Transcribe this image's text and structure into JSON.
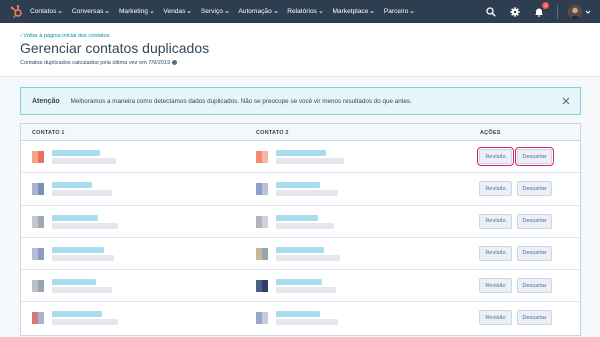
{
  "nav": {
    "items": [
      {
        "label": "Contatos"
      },
      {
        "label": "Conversas"
      },
      {
        "label": "Marketing"
      },
      {
        "label": "Vendas"
      },
      {
        "label": "Serviço"
      },
      {
        "label": "Automação"
      },
      {
        "label": "Relatórios"
      },
      {
        "label": "Marketplace"
      },
      {
        "label": "Parceiro"
      }
    ],
    "notification_count": "2"
  },
  "header": {
    "back_link": "Voltar à página inicial dos contatos",
    "title": "Gerenciar contatos duplicados",
    "subtitle": "Contatos duplicados calculados pela última vez em 7/9/2019"
  },
  "alert": {
    "label": "Atenção",
    "text": "Melhoramos a maneira como detectamos dados duplicados. Não se preocupe se você vir menos resultados do que antes."
  },
  "table": {
    "columns": [
      "CONTATO 1",
      "CONTATO 2",
      "AÇÕES"
    ],
    "review_label": "Revisão",
    "dismiss_label": "Descartar"
  },
  "colors": {
    "nav_bg": "#2d3e50",
    "accent": "#ff7a59",
    "link": "#0091ae",
    "highlight": "#d6226e"
  }
}
